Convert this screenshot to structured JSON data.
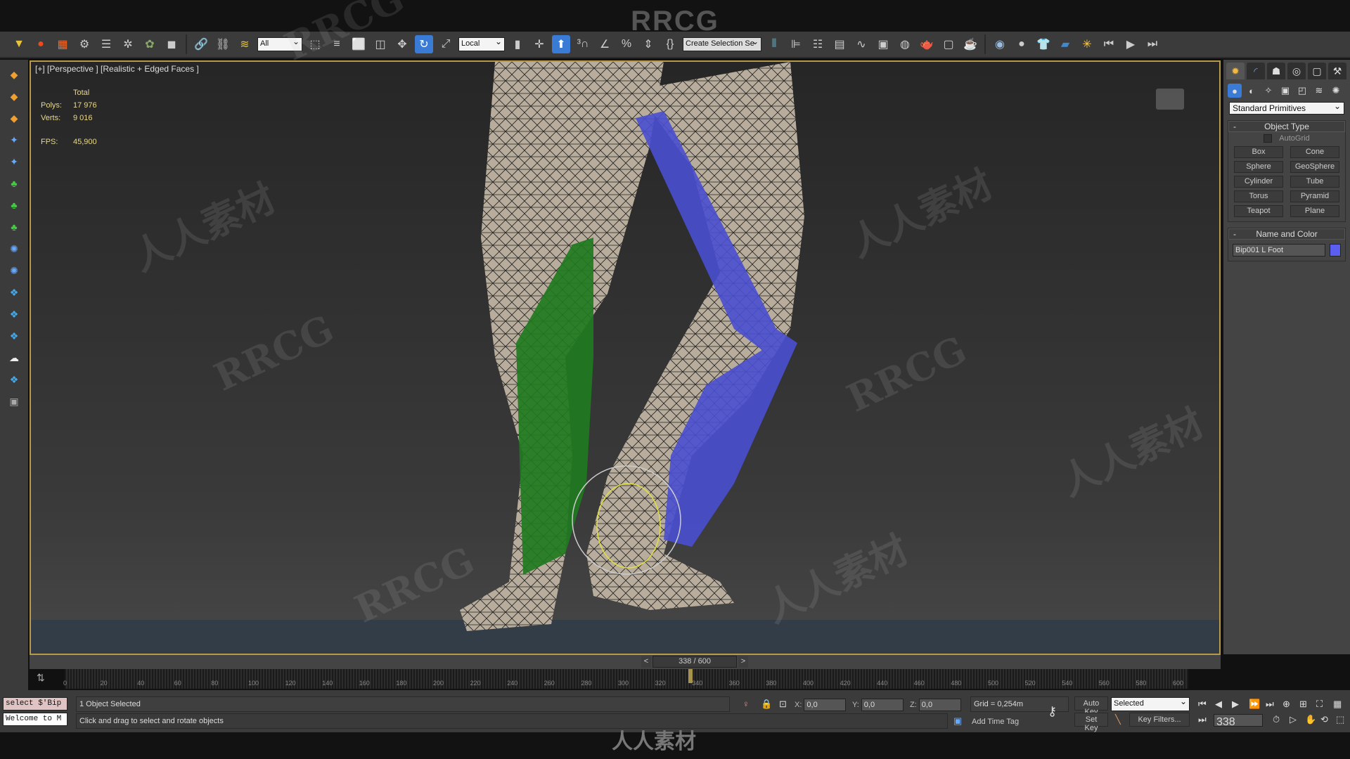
{
  "app_title": "RRCG",
  "toolbar": {
    "icons_left": [
      "select-link-icon",
      "unlink-icon",
      "bind-space-warp-icon"
    ],
    "filter": "All",
    "icons_mid": [
      "select-object-icon",
      "select-by-name-icon",
      "rect-selection-icon",
      "window-crossing-icon",
      "move-icon",
      "rotate-icon",
      "scale-icon"
    ],
    "coord_system": "Local",
    "icons_snap": [
      "pivot-icon",
      "manipulate-icon",
      "keyboard-shortcut-icon",
      "snap-3d-icon",
      "angle-snap-icon",
      "percent-snap-icon",
      "spinner-snap-icon",
      "edit-named-sets-icon"
    ],
    "named_selection": "Create Selection Se",
    "icons_right": [
      "mirror-icon",
      "align-icon",
      "layer-icon",
      "scene-explorer-icon",
      "curve-editor-icon",
      "schematic-icon",
      "material-editor-icon",
      "render-setup-icon",
      "rendered-frame-icon",
      "render-icon",
      "render-online-icon",
      "environment-icon",
      "sphere-icon",
      "cloth-icon",
      "eraser-icon",
      "particle-icon",
      "step-back-icon",
      "play-icon",
      "step-forward-icon"
    ]
  },
  "left_icons": [
    "create-icon",
    "create-icon",
    "create-icon",
    "bone-icon",
    "bone-icon",
    "plant-icon",
    "plant-icon",
    "plant-icon",
    "vdb-icon",
    "vdb-icon",
    "helper-icon",
    "helper-icon",
    "helper-icon",
    "cloud-icon",
    "helper-icon",
    "box-icon"
  ],
  "viewport": {
    "label": "[+] [Perspective ] [Realistic + Edged Faces ]",
    "stats": {
      "header": "Total",
      "polys_label": "Polys:",
      "polys": "17 976",
      "verts_label": "Verts:",
      "verts": "9 016",
      "fps_label": "FPS:",
      "fps": "45,900"
    }
  },
  "command_panel": {
    "tabs": [
      "create-tab",
      "modify-tab",
      "hierarchy-tab",
      "motion-tab",
      "display-tab",
      "utilities-tab"
    ],
    "subtabs": [
      "geometry-icon",
      "shapes-icon",
      "lights-icon",
      "cameras-icon",
      "helpers-icon",
      "spacewarps-icon",
      "systems-icon"
    ],
    "category": "Standard Primitives",
    "object_type": {
      "title": "Object Type",
      "collapse": "-",
      "autogrid": "AutoGrid",
      "buttons": [
        "Box",
        "Cone",
        "Sphere",
        "GeoSphere",
        "Cylinder",
        "Tube",
        "Torus",
        "Pyramid",
        "Teapot",
        "Plane"
      ]
    },
    "name_color": {
      "title": "Name and Color",
      "collapse": "-",
      "name": "Bip001 L Foot",
      "color": "#5a5ff0"
    }
  },
  "timeline": {
    "slider": "338 / 600",
    "prev": "<",
    "next": ">",
    "current": 338,
    "max": 600,
    "ticks": [
      0,
      20,
      40,
      60,
      80,
      100,
      120,
      140,
      160,
      180,
      200,
      220,
      240,
      260,
      280,
      300,
      320,
      340,
      360,
      380,
      400,
      420,
      440,
      460,
      480,
      500,
      520,
      540,
      560,
      580,
      600
    ]
  },
  "status": {
    "maxscript_line1": "select $'Bip",
    "maxscript_line2": "Welcome to M",
    "selected": "1 Object Selected",
    "prompt": "Click and drag to select and rotate objects",
    "x_label": "X:",
    "x": "0,0",
    "y_label": "Y:",
    "y": "0,0",
    "z_label": "Z:",
    "z": "0,0",
    "grid": "Grid = 0,254m",
    "add_time_tag": "Add Time Tag",
    "auto_key": "Auto Key",
    "set_key": "Set Key",
    "key_mode": "Selected",
    "key_filters": "Key Filters...",
    "frame": "338"
  },
  "watermark": "人人素材",
  "colors": {
    "viewport_border": "#b89a4a",
    "active_tool": "#3a7bd5",
    "left_leg_bone": "#1f7a1f",
    "right_leg_bone": "#4a4fd0"
  }
}
